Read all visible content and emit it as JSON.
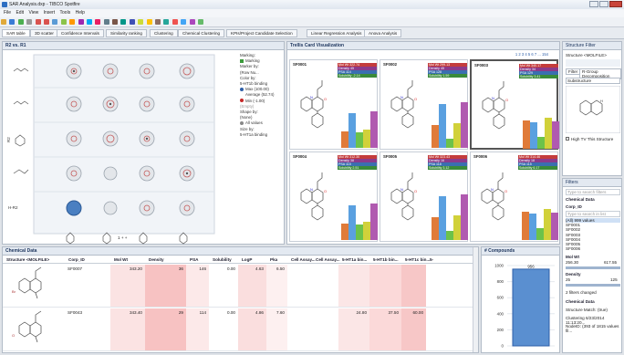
{
  "window": {
    "title": "SAR Analysis.dxp - TIBCO Spotfire"
  },
  "menu": [
    "File",
    "Edit",
    "View",
    "Insert",
    "Tools",
    "Help"
  ],
  "tabs": [
    "SAR table",
    "3D scatter",
    "Confidence Intervals",
    "Similarity ranking",
    "Clustering",
    "Chemical Clustering",
    "KPIs/Project Candidate Selection",
    "Linear Regression Analysis",
    "Anova Analysis"
  ],
  "r2r1": {
    "title": "R2 vs. R1",
    "legend": {
      "marking": "Marking:",
      "marking_value": "Marking",
      "marker_by": "Marker by:",
      "marker_by_value": "(Row Nu...",
      "color_by": "Color by:",
      "color_by_value": "5-HT1b binding",
      "max": "Max (100.00)",
      "avg": "Average (52.74)",
      "min": "Min (-1.00)",
      "empty": "(Empty)",
      "shape_by": "Shape by:",
      "shape_by_value": "(None)",
      "all_values": "All values",
      "size_by": "Size by:",
      "size_by_value": "5-HT1a binding",
      "axis_x": "R1",
      "axis_y": "R2",
      "rowlabel": "H-R2",
      "scroll_label": "1 + +"
    }
  },
  "trellis": {
    "title": "Trellis Card Visualization",
    "pages": "1 2 3 4 5 6 7 ... 154",
    "prop_labels": [
      "Mol Wt",
      "Density",
      "PSA",
      "Solubility"
    ],
    "cards": [
      {
        "id": "SF0001",
        "vals": [
          "322.74",
          "45",
          "114",
          "-2.14"
        ]
      },
      {
        "id": "SF0002",
        "vals": [
          "299.13",
          "45",
          "128",
          "1.59"
        ]
      },
      {
        "id": "SF0003",
        "vals": [
          "340.17",
          "34",
          "129",
          "3.41"
        ]
      },
      {
        "id": "SF0004",
        "vals": [
          "312.30",
          "38",
          "115",
          "2.51"
        ]
      },
      {
        "id": "SF0005",
        "vals": [
          "323.43",
          "16",
          "118",
          "3.12"
        ]
      },
      {
        "id": "SF0006",
        "vals": [
          "314.46",
          "18",
          "115",
          "6.17"
        ]
      }
    ]
  },
  "structure_filter": {
    "title": "Structure Filter",
    "column": "Structure <MOLFILE>",
    "tabs": [
      "Filter",
      "R-Group Decomposition"
    ],
    "mode": "Substructure",
    "checkbox": "High TV This Structure"
  },
  "filters": {
    "title": "Filters",
    "search_placeholder": "Type to search filters",
    "section": "Chemical Data",
    "corp_id": "Corp_ID",
    "corp_search": "Type to search in list",
    "corp_items": [
      "(All) 999 values",
      "SF0001",
      "SF0002",
      "SF0003",
      "SF0004",
      "SF0005",
      "SF0006"
    ],
    "mol_wt": "Mol Wt",
    "mol_min": "256.30",
    "mol_max": "617.55",
    "density": "Density",
    "dens_min": "25",
    "dens_max": "125",
    "changed": "2 filters changed",
    "chem_data": "Chemical Data",
    "structure_match": "Structure Match: (true)",
    "clustering": "Clustering 6/23/2014 11:13:20...",
    "nodeid": "NodeID: (393 of 1815 values fil..."
  },
  "chemdata": {
    "title": "Chemical Data",
    "columns": [
      "Structure <MOLFILE>",
      "Corp_ID",
      "Mol Wt",
      "Density",
      "PSA",
      "Solubility",
      "LogP",
      "Pka",
      "Cell Assay...",
      "Cell Assay...",
      "5-HT1a bin...",
      "5-HT1b bin...",
      "5-HT1c bin...",
      "5-"
    ],
    "rows": [
      {
        "corp": "SF0007",
        "molwt": "343.20",
        "density": "36",
        "psa": "146",
        "sol": "0.00",
        "logp": "4.63",
        "pka": "6.50",
        "c1": "",
        "c2": "",
        "h1a": "",
        "h1b": "",
        "h1c": ""
      },
      {
        "corp": "SF0043",
        "molwt": "343.40",
        "density": "29",
        "psa": "114",
        "sol": "0.00",
        "logp": "4.86",
        "pka": "7.60",
        "c1": "",
        "c2": "",
        "h1a": "24.80",
        "h1b": "37.50",
        "h1c": "60.00"
      }
    ]
  },
  "compounds": {
    "title": "# Compounds",
    "bar_label": "956",
    "yticks": [
      "1000",
      "800",
      "600",
      "400",
      "200",
      "0"
    ],
    "value": 956
  },
  "colors": {
    "accent": "#2e5fa8",
    "header": "#e3e9f1",
    "bar_blue": "#5aa0e0"
  }
}
